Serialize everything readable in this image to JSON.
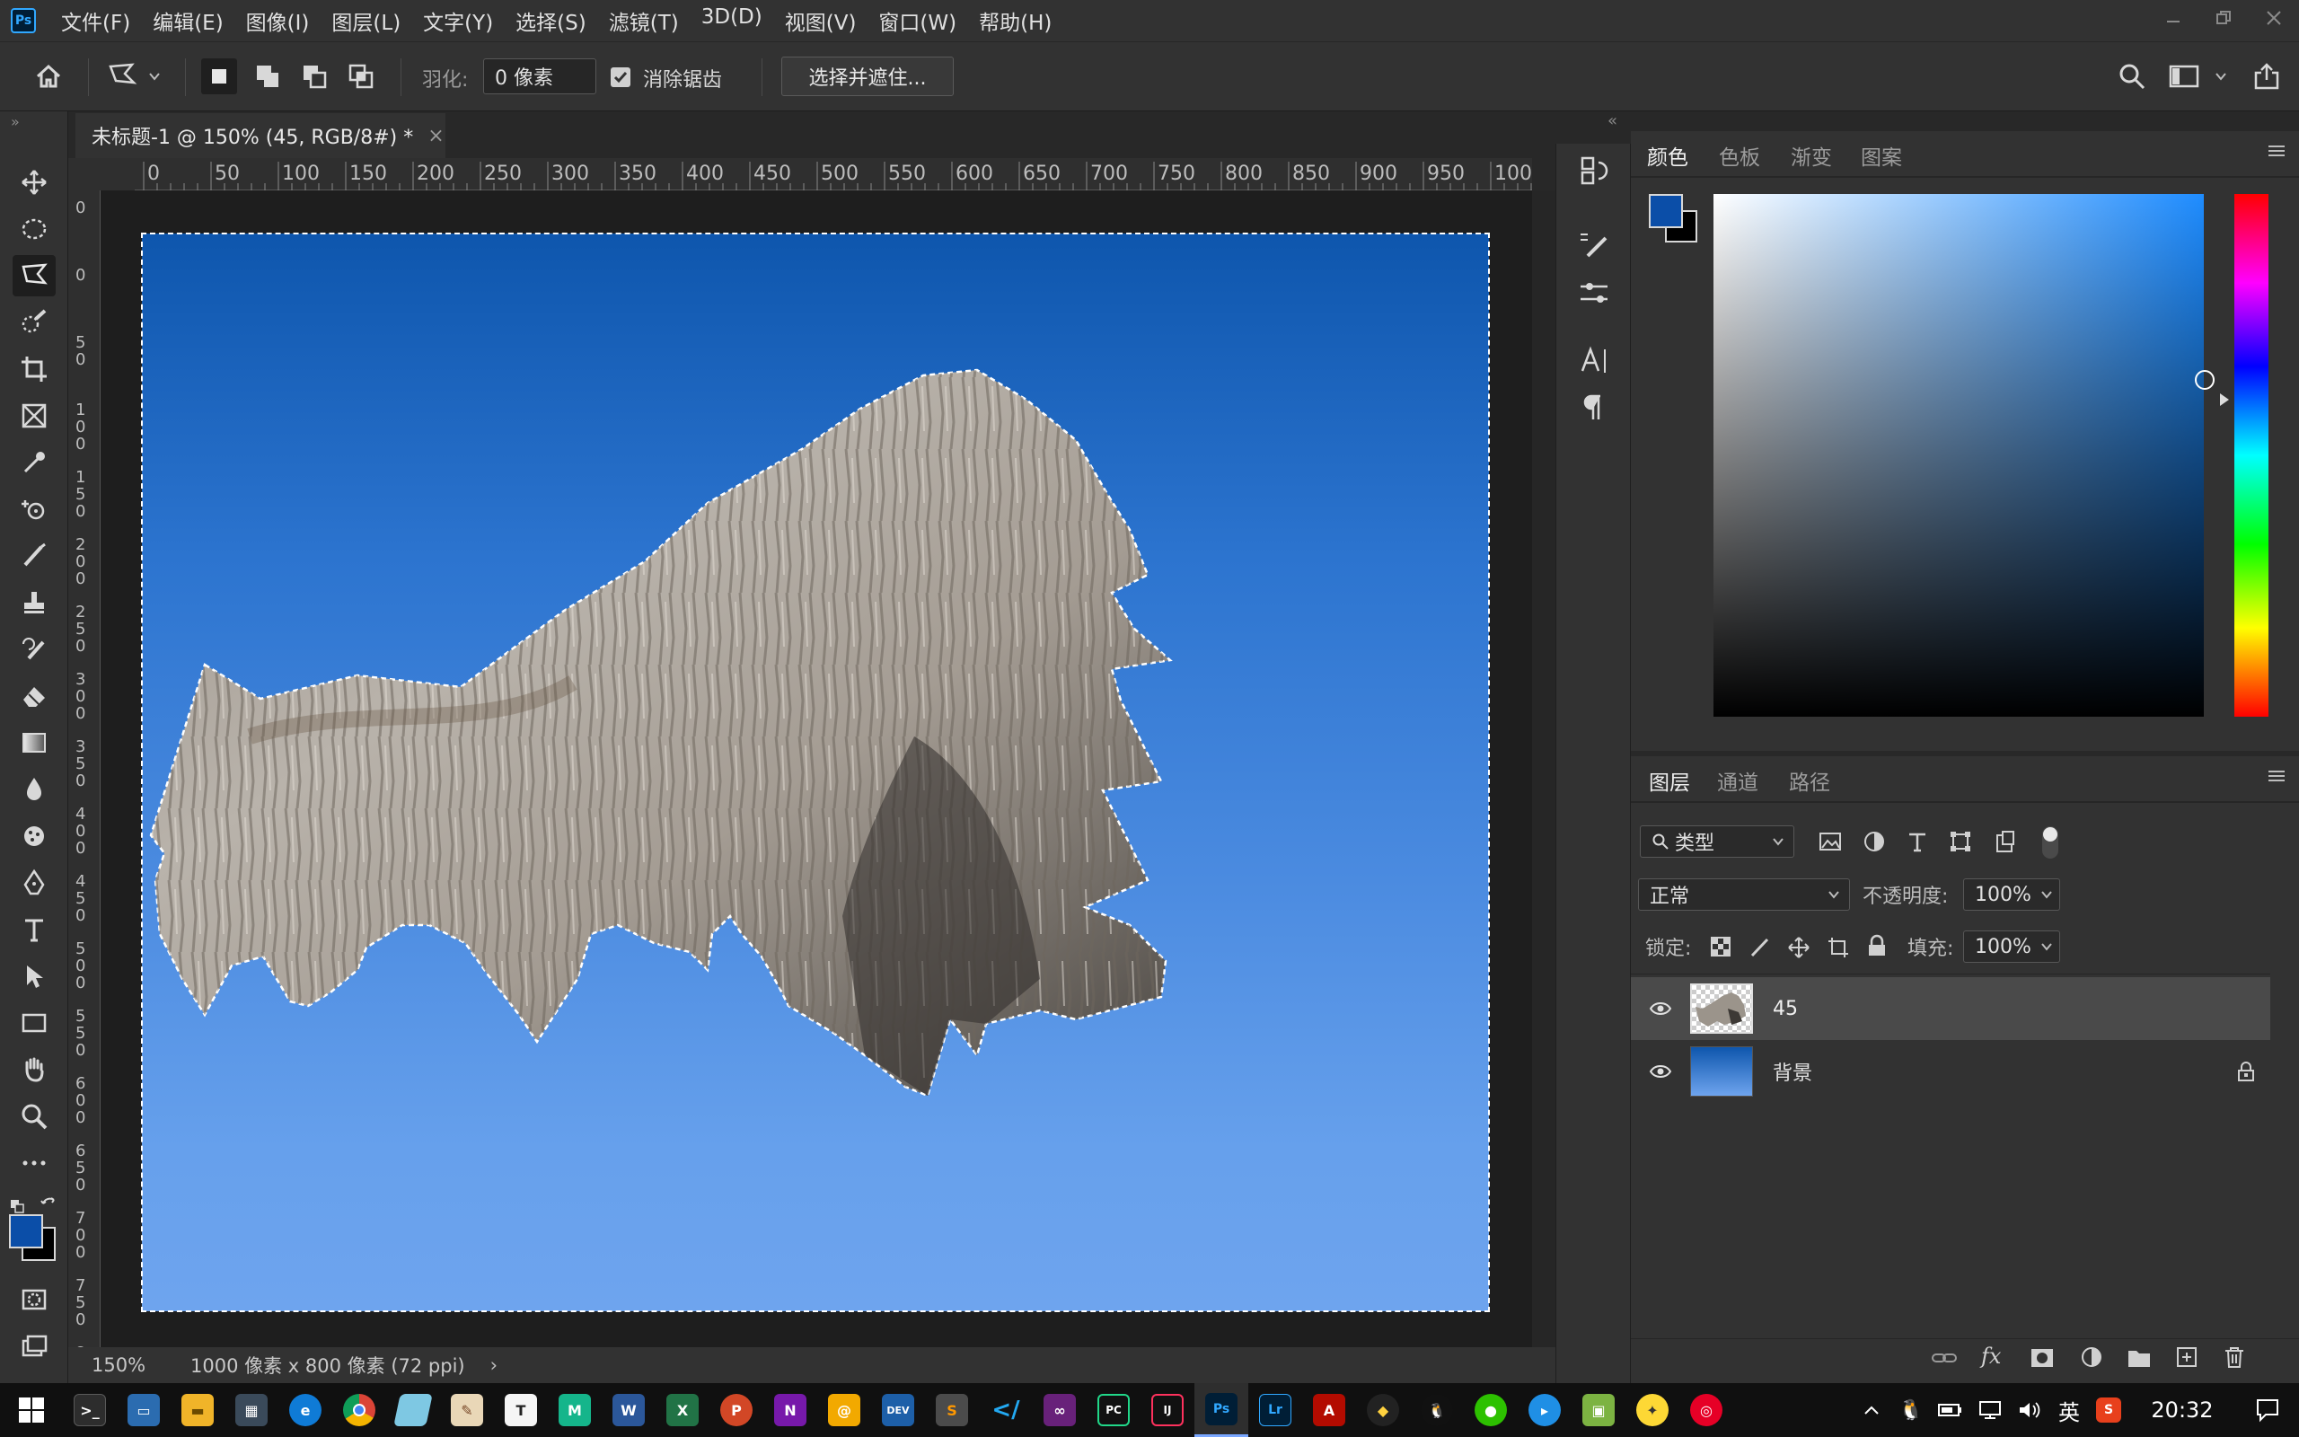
{
  "app": {
    "logo": "Ps"
  },
  "menu": [
    "文件(F)",
    "编辑(E)",
    "图像(I)",
    "图层(L)",
    "文字(Y)",
    "选择(S)",
    "滤镜(T)",
    "3D(D)",
    "视图(V)",
    "窗口(W)",
    "帮助(H)"
  ],
  "options": {
    "feather_label": "羽化:",
    "feather_value": "0 像素",
    "antialias_label": "消除锯齿",
    "antialias_checked": true,
    "select_mask_button": "选择并遮住..."
  },
  "document": {
    "tab_title": "未标题-1 @ 150% (45, RGB/8#) *",
    "zoom": "150%",
    "size_info": "1000 像素 x 800 像素 (72 ppi)"
  },
  "ruler_top_labels": [
    "0",
    "50",
    "100",
    "150",
    "200",
    "250",
    "300",
    "350",
    "400",
    "450",
    "500",
    "550",
    "600",
    "650",
    "700",
    "750",
    "800",
    "850",
    "900",
    "950",
    "100"
  ],
  "ruler_left_labels": [
    "0",
    "0",
    "5 0",
    "1 0 0",
    "1 5 0",
    "2 0 0",
    "2 5 0",
    "3 0 0",
    "3 5 0",
    "4 0 0",
    "4 5 0",
    "5 0 0",
    "5 5 0",
    "6 0 0",
    "6 5 0",
    "7 0 0",
    "7 5 0",
    "8"
  ],
  "color_panel": {
    "tabs": [
      "颜色",
      "色板",
      "渐变",
      "图案"
    ],
    "active_tab": "颜色",
    "foreground": "#0b4ea8",
    "background": "#000000"
  },
  "layers_panel": {
    "tabs": [
      "图层",
      "通道",
      "路径"
    ],
    "active_tab": "图层",
    "filter_label": "类型",
    "blend_mode": "正常",
    "opacity_label": "不透明度:",
    "opacity_value": "100%",
    "lock_label": "锁定:",
    "fill_label": "填充:",
    "fill_value": "100%",
    "layers": [
      {
        "name": "45",
        "visible": true,
        "selected": true,
        "locked": false
      },
      {
        "name": "背景",
        "visible": true,
        "selected": false,
        "locked": true
      }
    ]
  },
  "taskbar": {
    "ime": "英",
    "time": "20:32"
  }
}
